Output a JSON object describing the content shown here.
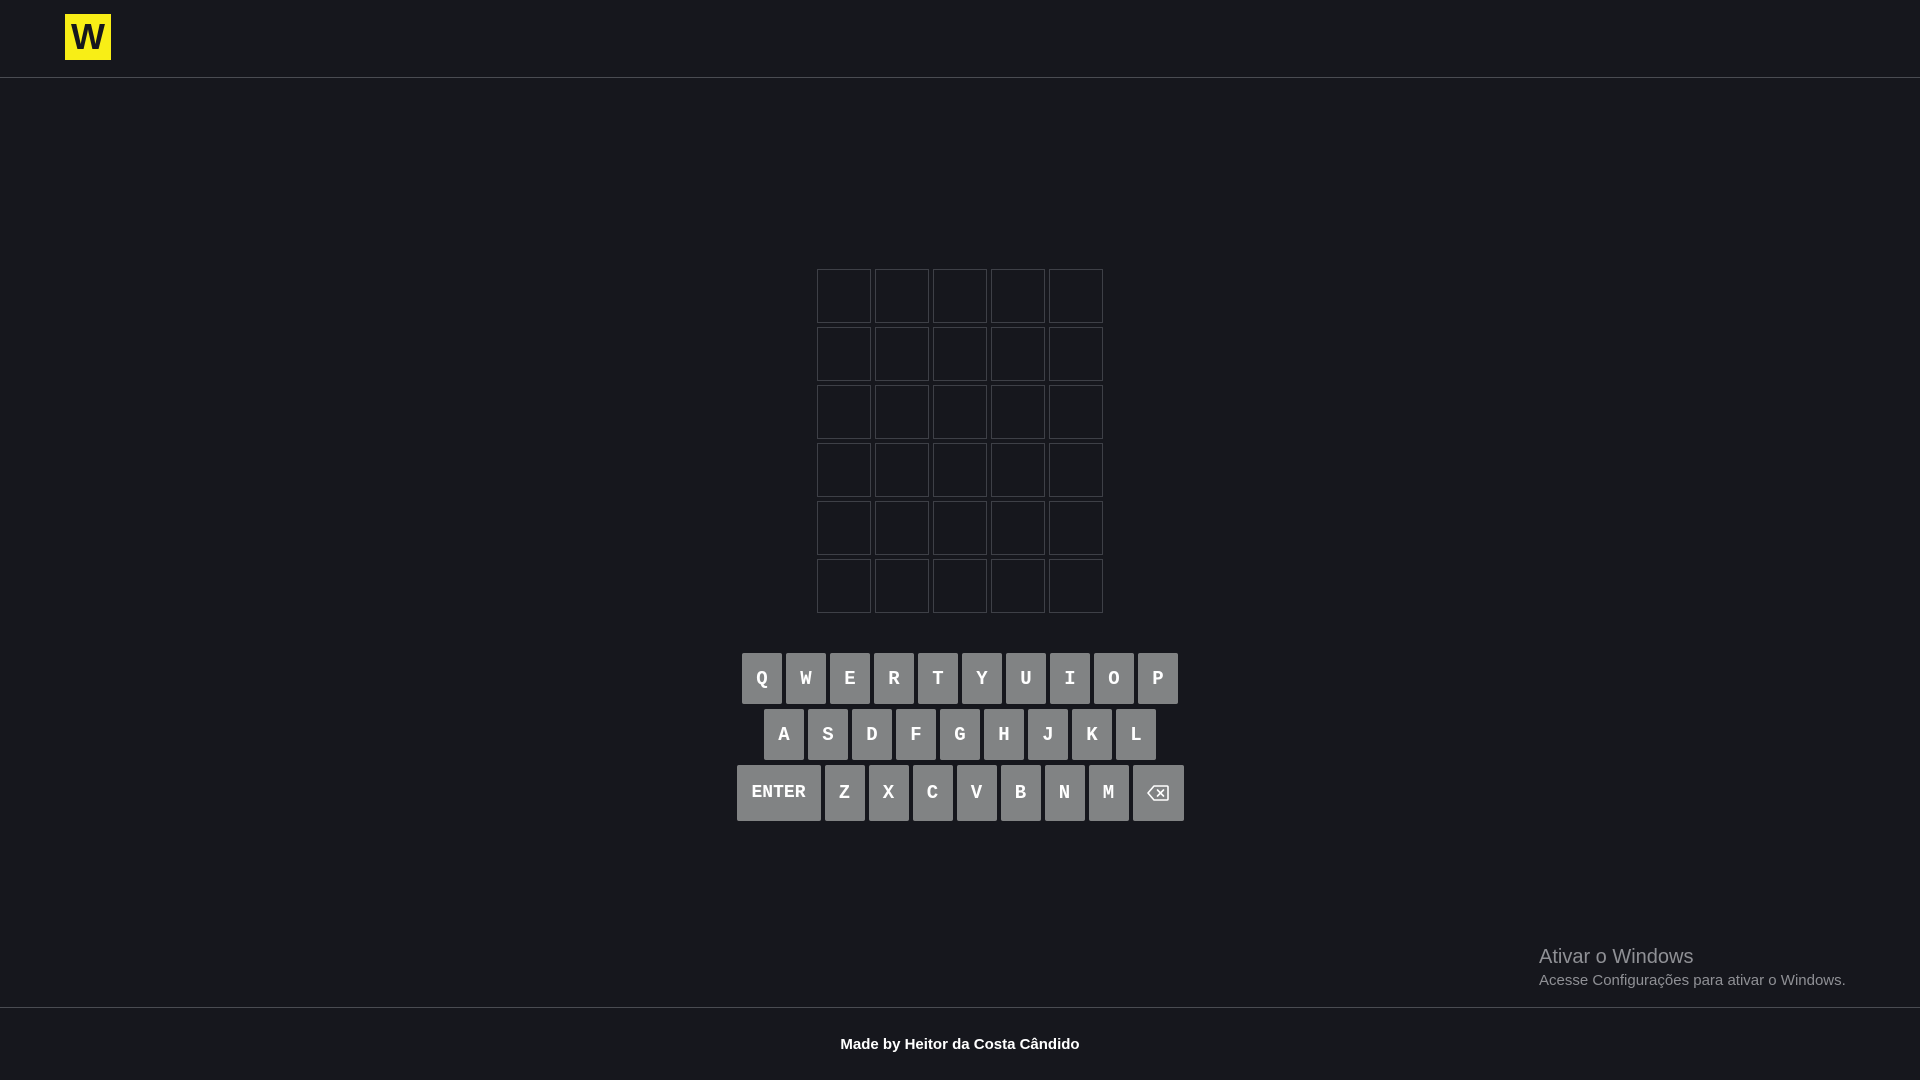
{
  "header": {
    "logo_text": "W"
  },
  "board": {
    "rows": [
      [
        "",
        "",
        "",
        "",
        ""
      ],
      [
        "",
        "",
        "",
        "",
        ""
      ],
      [
        "",
        "",
        "",
        "",
        ""
      ],
      [
        "",
        "",
        "",
        "",
        ""
      ],
      [
        "",
        "",
        "",
        "",
        ""
      ],
      [
        "",
        "",
        "",
        "",
        ""
      ]
    ]
  },
  "keyboard": {
    "row1": [
      "Q",
      "W",
      "E",
      "R",
      "T",
      "Y",
      "U",
      "I",
      "O",
      "P"
    ],
    "row2": [
      "A",
      "S",
      "D",
      "F",
      "G",
      "H",
      "J",
      "K",
      "L"
    ],
    "enter_label": "ENTER",
    "row3": [
      "Z",
      "X",
      "C",
      "V",
      "B",
      "N",
      "M"
    ],
    "backspace_icon": "backspace-icon",
    "key_color": "#818384"
  },
  "watermark": {
    "title": "Ativar o Windows",
    "subtitle": "Acesse Configurações para ativar o Windows."
  },
  "footer": {
    "credit": "Made by Heitor da Costa Cândido"
  },
  "colors": {
    "background": "#16171d",
    "logo_bg": "#f8ee16",
    "tile_border": "#3e4047"
  }
}
